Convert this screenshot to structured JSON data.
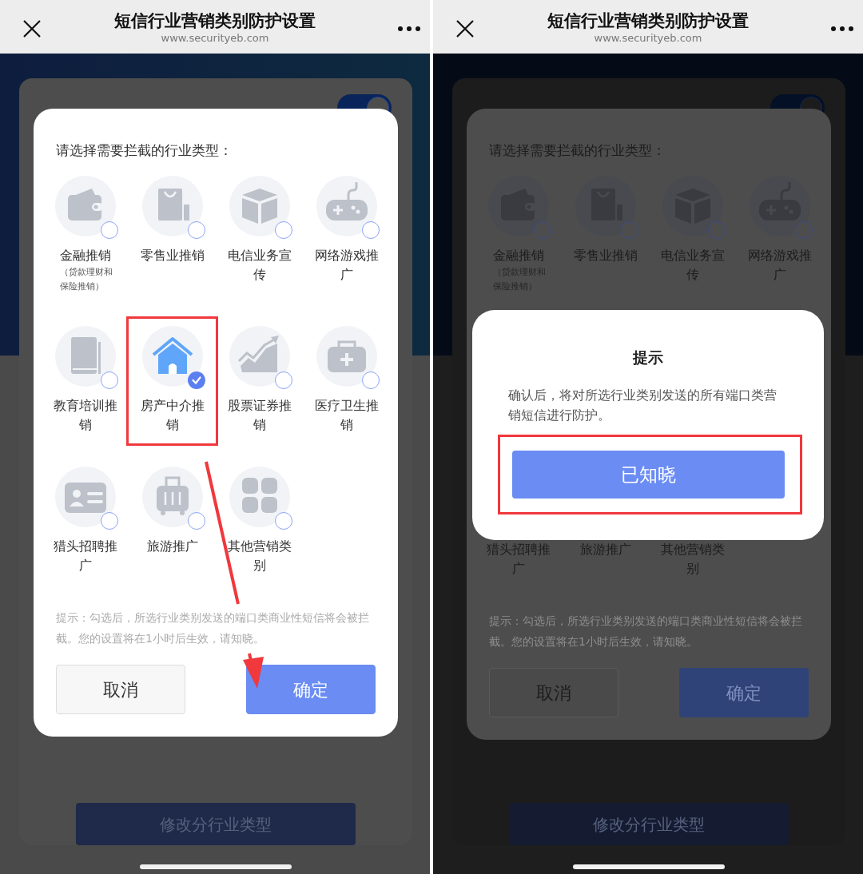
{
  "panels": [
    {
      "header": {
        "title": "短信行业营销类别防护设置",
        "subtitle": "www.securityeb.com"
      },
      "settings": {
        "switch_on": true,
        "edit_button": "修改分行业类型"
      },
      "dialog": {
        "prompt": "请选择需要拦截的行业类型：",
        "categories": [
          {
            "kind": "full",
            "label": "金融推销",
            "sublabel": "（贷款理财和保险推销）",
            "selected": false,
            "highlighted": false
          },
          {
            "kind": "full",
            "label": "零售业推销",
            "selected": false,
            "highlighted": false
          },
          {
            "kind": "full",
            "label": "电信业务宣传",
            "selected": false,
            "highlighted": false
          },
          {
            "kind": "full",
            "label": "网络游戏推广",
            "selected": false,
            "highlighted": false
          },
          {
            "kind": "full",
            "label": "教育培训推销",
            "selected": false,
            "highlighted": false
          },
          {
            "kind": "full",
            "label": "房产中介推销",
            "selected": true,
            "highlighted": true
          },
          {
            "kind": "full",
            "label": "股票证券推销",
            "selected": false,
            "highlighted": false
          },
          {
            "kind": "full",
            "label": "医疗卫生推销",
            "selected": false,
            "highlighted": false
          },
          {
            "kind": "full",
            "label": "猎头招聘推广",
            "selected": false,
            "highlighted": false
          },
          {
            "kind": "full",
            "label": "旅游推广",
            "selected": false,
            "highlighted": false
          },
          {
            "kind": "full",
            "label": "其他营销类别",
            "selected": false,
            "highlighted": false
          }
        ],
        "hint": "提示：勾选后，所选行业类别发送的端口类商业性短信将会被拦截。您的设置将在1小时后生效，请知晓。",
        "buttons": [
          {
            "label": "取消",
            "kind": "secondary"
          },
          {
            "label": "确定",
            "kind": "primary"
          }
        ]
      },
      "annotation_arrow": true
    },
    {
      "header": {
        "title": "短信行业营销类别防护设置",
        "subtitle": "www.securityeb.com"
      },
      "settings": {
        "switch_on": true,
        "edit_button": "修改分行业类型"
      },
      "dialog": {
        "prompt": "请选择需要拦截的行业类型：",
        "categories": [
          {
            "kind": "full",
            "label": "金融推销",
            "sublabel": "（贷款理财和保险推销）",
            "selected": false,
            "highlighted": false
          },
          {
            "kind": "full",
            "label": "零售业推销",
            "selected": false,
            "highlighted": false
          },
          {
            "kind": "full",
            "label": "电信业务宣传",
            "selected": false,
            "highlighted": false
          },
          {
            "kind": "full",
            "label": "网络游戏推广",
            "selected": false,
            "highlighted": false
          },
          {
            "kind": "label_only",
            "label": "猎头招聘推广"
          },
          {
            "kind": "label_only",
            "label": "旅游推广"
          },
          {
            "kind": "label_only",
            "label": "其他营销类别"
          }
        ],
        "hint": "提示：勾选后，所选行业类别发送的端口类商业性短信将会被拦截。您的设置将在1小时后生效，请知晓。",
        "buttons": [
          {
            "label": "取消",
            "kind": "secondary"
          },
          {
            "label": "确定",
            "kind": "primary"
          }
        ]
      },
      "alert": {
        "title": "提示",
        "message": "确认后，将对所选行业类别发送的所有端口类营销短信进行防护。",
        "button": "已知晓",
        "highlighted": true
      }
    }
  ]
}
